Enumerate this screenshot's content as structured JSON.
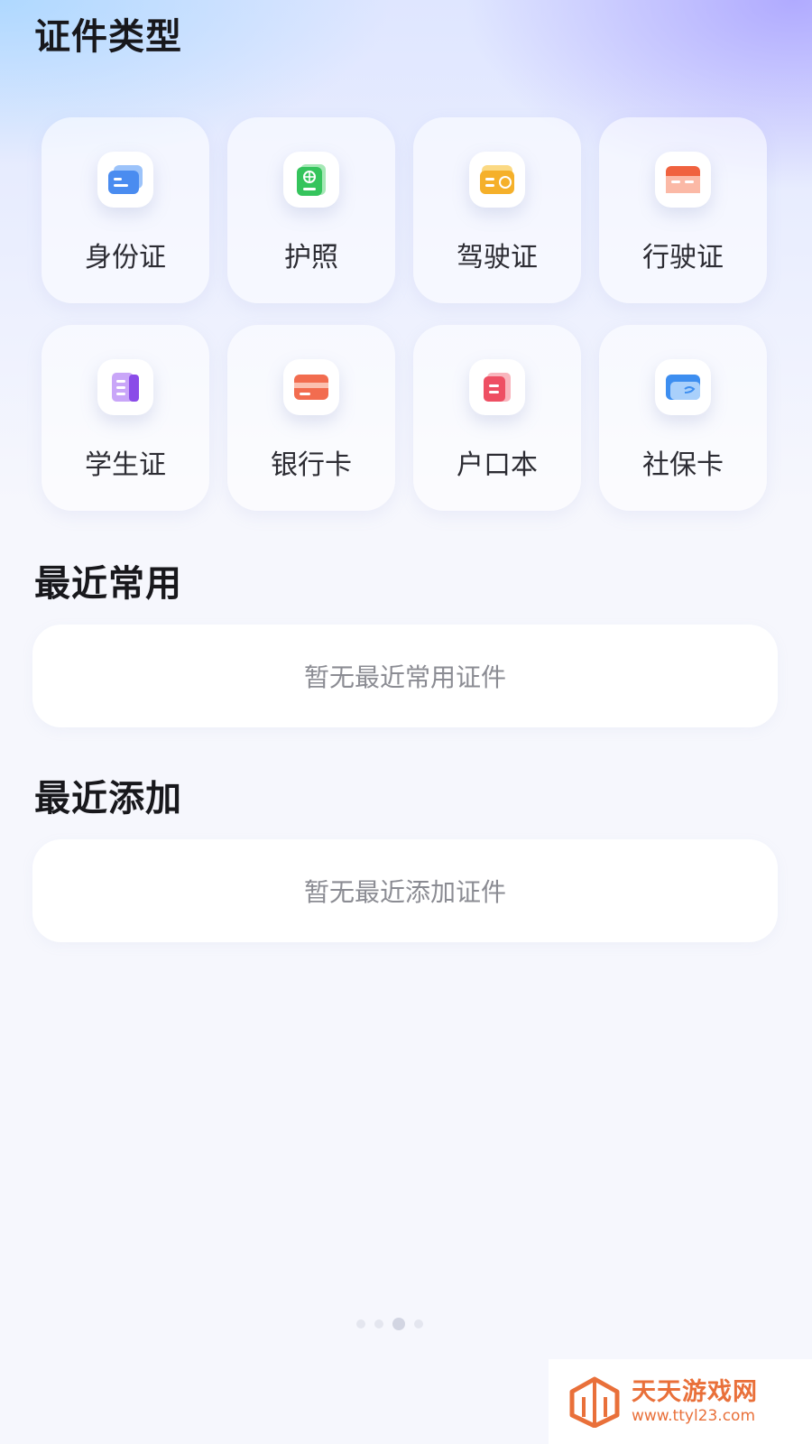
{
  "sections": {
    "types_title": "证件类型",
    "recent_used_title": "最近常用",
    "recent_added_title": "最近添加"
  },
  "doc_types": [
    {
      "label": "身份证",
      "icon": "id-card-icon",
      "color": "#4a8cf0"
    },
    {
      "label": "护照",
      "icon": "passport-icon",
      "color": "#35c45c"
    },
    {
      "label": "驾驶证",
      "icon": "driver-license-icon",
      "color": "#f5b02a"
    },
    {
      "label": "行驶证",
      "icon": "vehicle-license-icon",
      "color": "#f0623f"
    },
    {
      "label": "学生证",
      "icon": "student-card-icon",
      "color": "#a56af2"
    },
    {
      "label": "银行卡",
      "icon": "bank-card-icon",
      "color": "#f26c4f"
    },
    {
      "label": "户口本",
      "icon": "household-register-icon",
      "color": "#ee4f63"
    },
    {
      "label": "社保卡",
      "icon": "social-security-card-icon",
      "color": "#3d8ef0"
    }
  ],
  "recent_used": {
    "empty_text": "暂无最近常用证件"
  },
  "recent_added": {
    "empty_text": "暂无最近添加证件"
  },
  "pager": {
    "count": 4,
    "active_index": 2
  },
  "watermark": {
    "title": "天天游戏网",
    "url": "www.ttyl23.com",
    "color": "#e9703a"
  }
}
